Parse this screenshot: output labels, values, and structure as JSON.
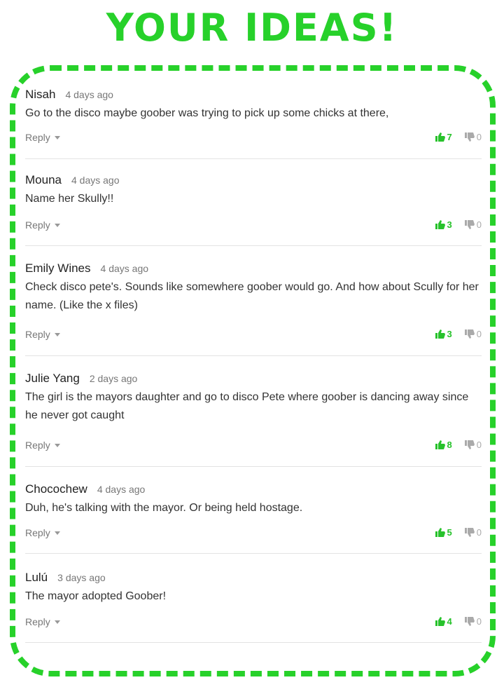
{
  "header": {
    "title": "YOUR IDEAS!"
  },
  "reply_label": "Reply",
  "colors": {
    "accent": "#27d12a",
    "upvote": "#27c22b",
    "downvote": "#aaaaaa"
  },
  "comments": [
    {
      "author": "Nisah",
      "time": "4 days ago",
      "text": "Go to the disco maybe goober was trying to pick up some chicks at there,",
      "up": "7",
      "down": "0"
    },
    {
      "author": "Mouna",
      "time": "4 days ago",
      "text": "Name her Skully!!",
      "up": "3",
      "down": "0"
    },
    {
      "author": "Emily Wines",
      "time": "4 days ago",
      "text": "Check disco pete's. Sounds like somewhere goober would go. And how about Scully for her name. (Like the x files)",
      "up": "3",
      "down": "0"
    },
    {
      "author": "Julie Yang",
      "time": "2 days ago",
      "text": "The girl is the mayors daughter and go to disco Pete where goober is dancing away since he never got caught",
      "up": "8",
      "down": "0"
    },
    {
      "author": "Chocochew",
      "time": "4 days ago",
      "text": "Duh, he's talking with the mayor. Or being held hostage.",
      "up": "5",
      "down": "0"
    },
    {
      "author": "Lulú",
      "time": "3 days ago",
      "text": "The mayor adopted Goober!",
      "up": "4",
      "down": "0"
    }
  ]
}
